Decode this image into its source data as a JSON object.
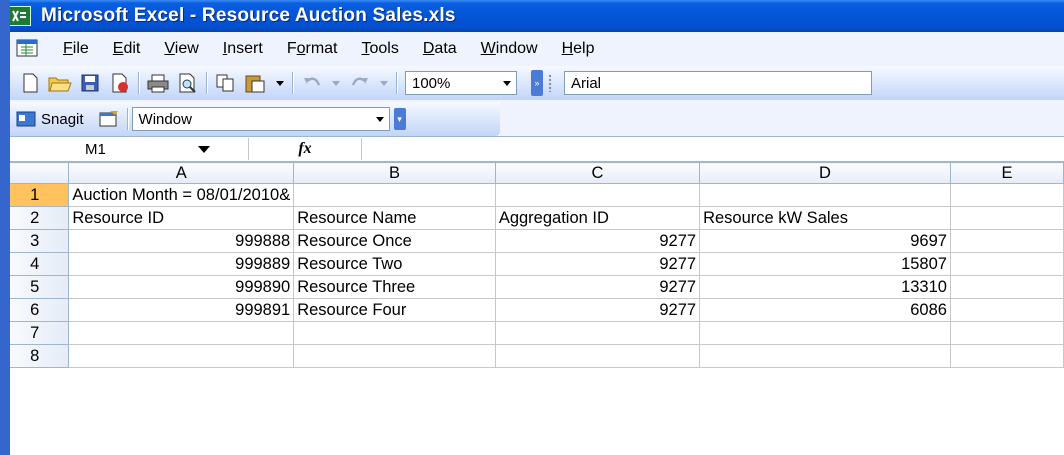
{
  "window": {
    "title": "Microsoft Excel - Resource Auction Sales.xls",
    "app_icon": "excel-icon"
  },
  "menu": {
    "items": [
      {
        "label": "File",
        "ul": "F",
        "rest": "ile"
      },
      {
        "label": "Edit",
        "ul": "E",
        "rest": "dit"
      },
      {
        "label": "View",
        "ul": "V",
        "rest": "iew"
      },
      {
        "label": "Insert",
        "ul": "I",
        "rest": "nsert"
      },
      {
        "label": "Format",
        "ul": "o",
        "pre": "F",
        "rest": "rmat"
      },
      {
        "label": "Tools",
        "ul": "T",
        "rest": "ools"
      },
      {
        "label": "Data",
        "ul": "D",
        "rest": "ata"
      },
      {
        "label": "Window",
        "ul": "W",
        "rest": "indow"
      },
      {
        "label": "Help",
        "ul": "H",
        "rest": "elp"
      }
    ]
  },
  "toolbar": {
    "zoom": "100%",
    "font": "Arial",
    "snagit_label": "Snagit",
    "window_select": "Window"
  },
  "formula_bar": {
    "name_box": "M1",
    "fx_label": "fx",
    "content": ""
  },
  "sheet": {
    "columns": [
      "A",
      "B",
      "C",
      "D",
      "E"
    ],
    "rows": [
      {
        "num": "1",
        "cells": [
          "Auction Month = 08/01/2010&",
          "",
          "",
          "",
          ""
        ]
      },
      {
        "num": "2",
        "cells": [
          "Resource ID",
          "Resource Name",
          "Aggregation ID",
          "Resource kW Sales",
          ""
        ]
      },
      {
        "num": "3",
        "cells": [
          "999888",
          "Resource Once",
          "9277",
          "9697",
          ""
        ]
      },
      {
        "num": "4",
        "cells": [
          "999889",
          "Resource Two",
          "9277",
          "15807",
          ""
        ]
      },
      {
        "num": "5",
        "cells": [
          "999890",
          "Resource Three",
          "9277",
          "13310",
          ""
        ]
      },
      {
        "num": "6",
        "cells": [
          "999891",
          "Resource Four",
          "9277",
          "6086",
          ""
        ]
      },
      {
        "num": "7",
        "cells": [
          "",
          "",
          "",
          "",
          ""
        ]
      },
      {
        "num": "8",
        "cells": [
          "",
          "",
          "",
          "",
          ""
        ]
      }
    ]
  }
}
